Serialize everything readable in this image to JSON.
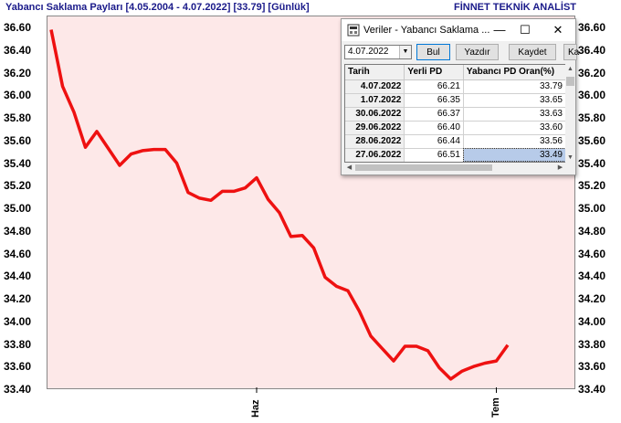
{
  "header": {
    "title": "Yabancı Saklama Payları  [4.05.2004 - 4.07.2022]  [33.79]  [Günlük]",
    "brand": "FİNNET TEKNİK ANALİST"
  },
  "chart_data": {
    "type": "line",
    "y_ticks": [
      "36.60",
      "36.40",
      "36.20",
      "36.00",
      "35.80",
      "35.60",
      "35.40",
      "35.20",
      "35.00",
      "34.80",
      "34.60",
      "34.40",
      "34.20",
      "34.00",
      "33.80",
      "33.60",
      "33.40"
    ],
    "x_ticks": [
      "Haz",
      "Tem"
    ],
    "ylim": [
      33.4,
      36.6
    ],
    "color": "#ee1111",
    "values": [
      36.58,
      36.08,
      35.85,
      35.54,
      35.68,
      35.53,
      35.38,
      35.48,
      35.51,
      35.52,
      35.52,
      35.4,
      35.14,
      35.09,
      35.07,
      35.15,
      35.15,
      35.18,
      35.27,
      35.08,
      34.96,
      34.75,
      34.76,
      34.65,
      34.39,
      34.31,
      34.27,
      34.09,
      33.87,
      33.76,
      33.65,
      33.78,
      33.78,
      33.74,
      33.59,
      33.49,
      33.56,
      33.6,
      33.63,
      33.65,
      33.79
    ],
    "x_tick_index": [
      18,
      39
    ]
  },
  "window": {
    "title": "Veriler - Yabancı Saklama ...",
    "minimize": "—",
    "maximize": "☐",
    "close": "✕",
    "date_value": "4.07.2022",
    "buttons": {
      "find": "Bul",
      "print": "Yazdır",
      "save": "Kaydet",
      "close": "Ka"
    },
    "columns": [
      "Tarih",
      "Yerli PD",
      "Yabancı PD Oran(%)"
    ],
    "rows": [
      [
        "4.07.2022",
        "66.21",
        "33.79"
      ],
      [
        "1.07.2022",
        "66.35",
        "33.65"
      ],
      [
        "30.06.2022",
        "66.37",
        "33.63"
      ],
      [
        "29.06.2022",
        "66.40",
        "33.60"
      ],
      [
        "28.06.2022",
        "66.44",
        "33.56"
      ],
      [
        "27.06.2022",
        "66.51",
        "33.49"
      ]
    ]
  }
}
